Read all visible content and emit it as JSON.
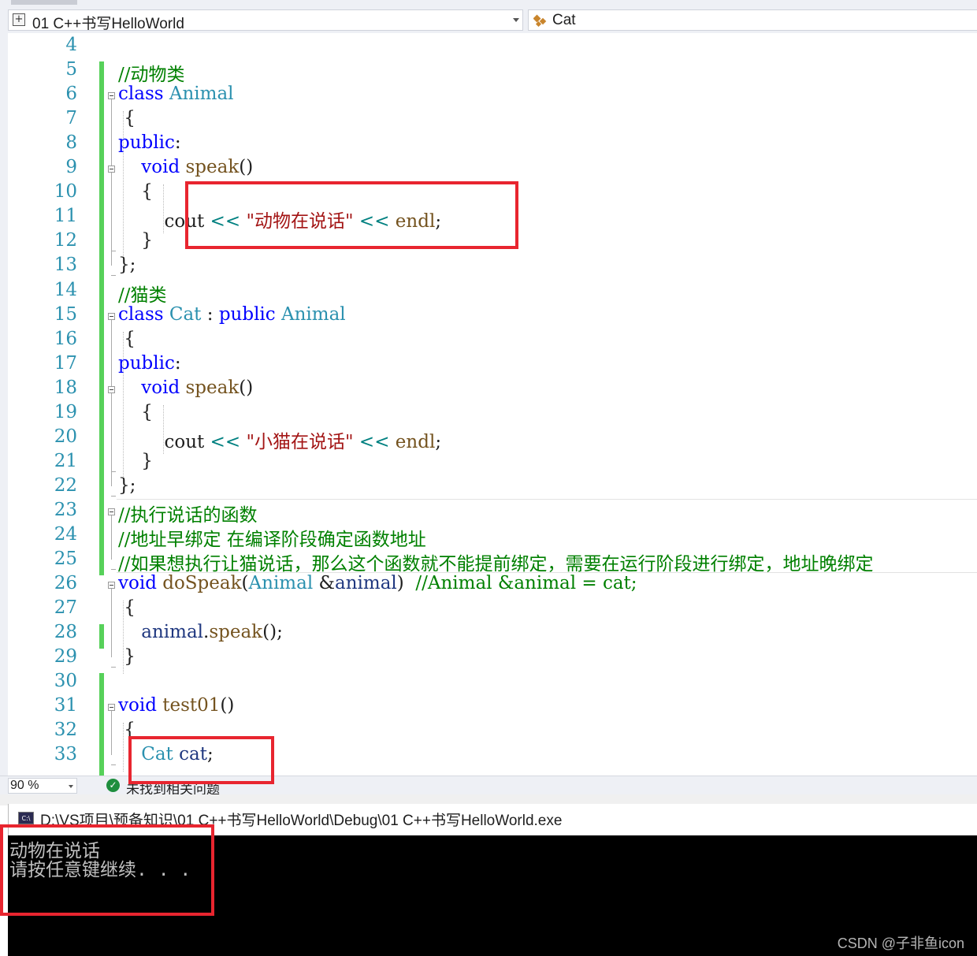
{
  "nav": {
    "file_combo": "01 C++书写HelloWorld",
    "class_combo": "Cat"
  },
  "editor": {
    "lines": [
      {
        "n": "4",
        "code": []
      },
      {
        "n": "5",
        "code": [
          {
            "c": "cm",
            "t": "//动物类"
          }
        ]
      },
      {
        "n": "6",
        "code": [
          {
            "c": "kw",
            "t": "class "
          },
          {
            "c": "ty",
            "t": "Animal"
          }
        ]
      },
      {
        "n": "7",
        "code": [
          {
            "c": "",
            "t": " {"
          }
        ]
      },
      {
        "n": "8",
        "code": [
          {
            "c": "kw",
            "t": "public"
          },
          {
            "c": "",
            "t": ":"
          }
        ]
      },
      {
        "n": "9",
        "code": [
          {
            "c": "",
            "t": "    "
          },
          {
            "c": "kw",
            "t": "void "
          },
          {
            "c": "fn",
            "t": "speak"
          },
          {
            "c": "",
            "t": "()"
          }
        ]
      },
      {
        "n": "10",
        "code": [
          {
            "c": "",
            "t": "    {"
          }
        ]
      },
      {
        "n": "11",
        "code": [
          {
            "c": "",
            "t": "        cout "
          },
          {
            "c": "op",
            "t": "<< "
          },
          {
            "c": "st",
            "t": "\"动物在说话\""
          },
          {
            "c": "op",
            "t": " << "
          },
          {
            "c": "fn",
            "t": "endl"
          },
          {
            "c": "",
            "t": ";"
          }
        ]
      },
      {
        "n": "12",
        "code": [
          {
            "c": "",
            "t": "    }"
          }
        ]
      },
      {
        "n": "13",
        "code": [
          {
            "c": "",
            "t": "};"
          }
        ]
      },
      {
        "n": "14",
        "code": [
          {
            "c": "cm",
            "t": "//猫类"
          }
        ]
      },
      {
        "n": "15",
        "code": [
          {
            "c": "kw",
            "t": "class "
          },
          {
            "c": "ty",
            "t": "Cat"
          },
          {
            "c": "",
            "t": " : "
          },
          {
            "c": "kw",
            "t": "public "
          },
          {
            "c": "ty",
            "t": "Animal"
          }
        ]
      },
      {
        "n": "16",
        "code": [
          {
            "c": "",
            "t": " {"
          }
        ]
      },
      {
        "n": "17",
        "code": [
          {
            "c": "kw",
            "t": "public"
          },
          {
            "c": "",
            "t": ":"
          }
        ]
      },
      {
        "n": "18",
        "code": [
          {
            "c": "",
            "t": "    "
          },
          {
            "c": "kw",
            "t": "void "
          },
          {
            "c": "fn",
            "t": "speak"
          },
          {
            "c": "",
            "t": "()"
          }
        ]
      },
      {
        "n": "19",
        "code": [
          {
            "c": "",
            "t": "    {"
          }
        ]
      },
      {
        "n": "20",
        "code": [
          {
            "c": "",
            "t": "        cout "
          },
          {
            "c": "op",
            "t": "<< "
          },
          {
            "c": "st",
            "t": "\"小猫在说话\""
          },
          {
            "c": "op",
            "t": " << "
          },
          {
            "c": "fn",
            "t": "endl"
          },
          {
            "c": "",
            "t": ";"
          }
        ]
      },
      {
        "n": "21",
        "code": [
          {
            "c": "",
            "t": "    }"
          }
        ]
      },
      {
        "n": "22",
        "code": [
          {
            "c": "",
            "t": "};"
          }
        ]
      },
      {
        "n": "23",
        "code": [
          {
            "c": "cm",
            "t": "//执行说话的函数"
          }
        ]
      },
      {
        "n": "24",
        "code": [
          {
            "c": "cm",
            "t": "//地址早绑定 在编译阶段确定函数地址"
          }
        ]
      },
      {
        "n": "25",
        "code": [
          {
            "c": "cm",
            "t": "//如果想执行让猫说话，那么这个函数就不能提前绑定，需要在运行阶段进行绑定，地址晚绑定"
          }
        ]
      },
      {
        "n": "26",
        "code": [
          {
            "c": "kw",
            "t": "void "
          },
          {
            "c": "fn",
            "t": "doSpeak"
          },
          {
            "c": "",
            "t": "("
          },
          {
            "c": "ty",
            "t": "Animal"
          },
          {
            "c": "",
            "t": " &"
          },
          {
            "c": "va",
            "t": "animal"
          },
          {
            "c": "",
            "t": ")  "
          },
          {
            "c": "cm",
            "t": "//Animal &animal = cat;"
          }
        ]
      },
      {
        "n": "27",
        "code": [
          {
            "c": "",
            "t": " {"
          }
        ]
      },
      {
        "n": "28",
        "code": [
          {
            "c": "",
            "t": "    "
          },
          {
            "c": "va",
            "t": "animal"
          },
          {
            "c": "",
            "t": "."
          },
          {
            "c": "fn",
            "t": "speak"
          },
          {
            "c": "",
            "t": "();"
          }
        ]
      },
      {
        "n": "29",
        "code": [
          {
            "c": "",
            "t": " }"
          }
        ]
      },
      {
        "n": "30",
        "code": []
      },
      {
        "n": "31",
        "code": [
          {
            "c": "kw",
            "t": "void "
          },
          {
            "c": "fn",
            "t": "test01"
          },
          {
            "c": "",
            "t": "()"
          }
        ]
      },
      {
        "n": "32",
        "code": [
          {
            "c": "",
            "t": " {"
          }
        ]
      },
      {
        "n": "33",
        "code": [
          {
            "c": "",
            "t": "    "
          },
          {
            "c": "ty",
            "t": "Cat"
          },
          {
            "c": "",
            "t": " "
          },
          {
            "c": "va",
            "t": "cat"
          },
          {
            "c": "",
            "t": ";"
          }
        ]
      }
    ]
  },
  "status": {
    "zoom": "90 %",
    "message": "未找到相关问题"
  },
  "console": {
    "title": "D:\\VS项目\\预备知识\\01 C++书写HelloWorld\\Debug\\01 C++书写HelloWorld.exe",
    "lines": [
      "动物在说话",
      "请按任意键继续. . ."
    ]
  },
  "watermark": "CSDN @子非鱼icon",
  "colors": {
    "keyword": "#0000ff",
    "type": "#2b91af",
    "comment": "#008000",
    "string": "#a31515",
    "highlight_box": "#e8252f",
    "change_bar": "#57d15a"
  },
  "icons": {
    "file_combo": "project-file-icon",
    "class_combo": "class-icon",
    "status": "check-circle-icon",
    "console": "console-app-icon"
  }
}
